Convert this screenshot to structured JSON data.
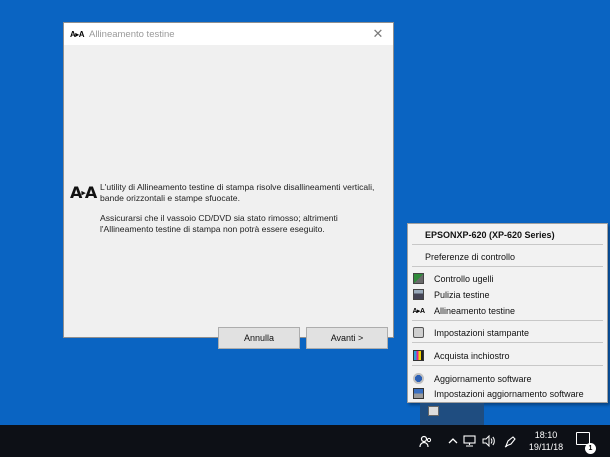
{
  "dialog": {
    "title": "Allineamento testine",
    "title_icon": "A▸A",
    "close_icon": "close-icon",
    "message1": "L'utility di Allineamento testine di stampa risolve disallineamenti verticali, bande orizzontali e stampe sfuocate.",
    "message2": "Assicurarsi che il vassoio CD/DVD sia stato rimosso; altrimenti l'Allineamento testine di stampa non potrà essere eseguito.",
    "buttons": {
      "cancel": "Annulla",
      "next": "Avanti >"
    }
  },
  "menu": {
    "header": "EPSONXP-620 (XP-620 Series)",
    "items": [
      {
        "label": "Preferenze di controllo",
        "icon": ""
      },
      {
        "label": "Controllo ugelli",
        "icon": "nozzle-check-icon"
      },
      {
        "label": "Pulizia testine",
        "icon": "head-cleaning-icon"
      },
      {
        "label": "Allineamento testine",
        "icon": "head-alignment-icon"
      },
      {
        "label": "Impostazioni stampante",
        "icon": "printer-settings-icon"
      },
      {
        "label": "Acquista inchiostro",
        "icon": "buy-ink-icon"
      },
      {
        "label": "Aggiornamento software",
        "icon": "software-update-icon"
      },
      {
        "label": "Impostazioni aggiornamento software",
        "icon": "software-update-settings-icon"
      }
    ]
  },
  "taskbar": {
    "time": "18:10",
    "date": "19/11/18",
    "notification_count": "1"
  },
  "colors": {
    "desktop": "#0a64c2",
    "taskbar": "#0d1016",
    "dialog_bg": "#f0f0f0"
  }
}
